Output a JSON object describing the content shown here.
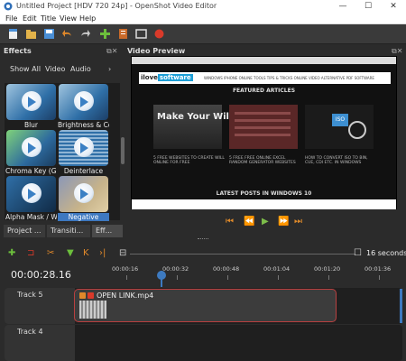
{
  "window": {
    "title": "Untitled Project [HDV 720 24p] - OpenShot Video Editor",
    "controls": [
      "—",
      "☐",
      "✕"
    ]
  },
  "menu": [
    "File",
    "Edit",
    "Title",
    "View",
    "Help"
  ],
  "effects_panel": {
    "title": "Effects",
    "tabs": [
      "Show All",
      "Video",
      "Audio"
    ],
    "items": [
      {
        "label": "Blur",
        "selected": false
      },
      {
        "label": "Brightness & Co...",
        "selected": false
      },
      {
        "label": "Chroma Key (Gr...",
        "selected": false
      },
      {
        "label": "Deinterlace",
        "selected": false
      },
      {
        "label": "Alpha Mask / W...",
        "selected": false
      },
      {
        "label": "Negative",
        "selected": true
      }
    ],
    "bottom_tabs": [
      "Project ...",
      "Transiti...",
      "Eff..."
    ]
  },
  "preview_panel": {
    "title": "Video Preview",
    "site": {
      "logo_left": "ilove",
      "logo_right": "software",
      "nav": "WINDOWS  IPHONE  ONLINE TOOLS  TIPS & TRICKS  ONLINE VIDEO  ALTERNATIVE  PDF SOFTWARE",
      "featured": "FEATURED ARTICLES",
      "card1_text": "Make Your Will",
      "card3_badge": "ISO",
      "captions": [
        "5 FREE WEBSITES TO CREATE WILL ONLINE FOR FREE",
        "5 FREE FREE ONLINE EXCEL RANDOM GENERATOR WEBSITES",
        "HOW TO CONVERT ISO TO BIN, CUE, CDI ETC. IN WINDOWS"
      ],
      "latest": "LATEST POSTS IN WINDOWS 10"
    },
    "controls": [
      "⏮",
      "⏪",
      "▶",
      "⏩",
      "⏭"
    ]
  },
  "timeline": {
    "seconds_label": "16 seconds",
    "timecode": "00:00:28.16",
    "ruler": [
      "00:00:16",
      "00:00:32",
      "00:00:48",
      "00:01:04",
      "00:01:20",
      "00:01:36"
    ],
    "tracks": [
      {
        "name": "Track 5"
      },
      {
        "name": "Track 4"
      }
    ],
    "clip": {
      "name": "OPEN LINK.mp4"
    }
  },
  "colors": {
    "accent": "#3d78c0",
    "clip_border": "#b94040",
    "play": "#7dbd4a",
    "transport": "#e08a2a"
  }
}
